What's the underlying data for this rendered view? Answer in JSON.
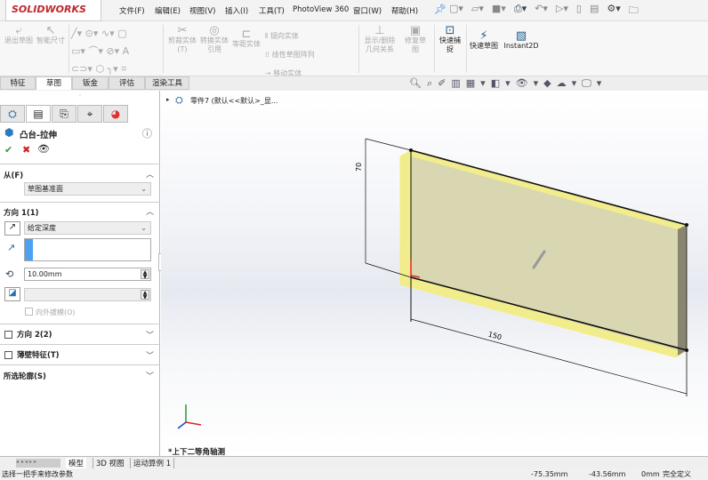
{
  "app": {
    "logo": "SOLIDWORKS"
  },
  "menu": [
    "文件(F)",
    "编辑(E)",
    "视图(V)",
    "插入(I)",
    "工具(T)",
    "PhotoView 360",
    "窗口(W)",
    "帮助(H)"
  ],
  "ribbon": {
    "exit_sketch": "退出草图",
    "smart_dim": "智能尺寸",
    "trim": "剪裁实体(T)",
    "convert": "转换实体引用",
    "offset": "等距实体",
    "mirror": "镜向实体",
    "linear_pattern": "线性草图阵列",
    "move": "移动实体",
    "relations": "显示/删除几何关系",
    "repair": "修复草图",
    "quick_snap": "快速捕捉",
    "rapid_sketch": "快速草图",
    "instant2d": "Instant2D"
  },
  "tabs": [
    "特征",
    "草图",
    "钣金",
    "评估",
    "渲染工具"
  ],
  "active_tab": 1,
  "panel": {
    "title": "凸台-拉伸",
    "from_label": "从(F)",
    "from_value": "草图基准面",
    "dir1_label": "方向 1(1)",
    "dir1_type": "给定深度",
    "depth": "10.00mm",
    "draft_label": "向外拔模(O)",
    "dir2_label": "方向 2(2)",
    "thin_label": "薄壁特征(T)",
    "contours_label": "所选轮廓(S)"
  },
  "tree": {
    "part": "零件7  (默认<<默认>_显..."
  },
  "model": {
    "dim_height": "70",
    "dim_width": "150",
    "view_name": "*上下二等角轴测",
    "face_color": "#d9d6b2",
    "edge_color": "#f5ef7a"
  },
  "bottom_tabs": [
    "模型",
    "3D 视图",
    "运动算例 1"
  ],
  "status": {
    "message": "选择一把手来修改参数",
    "x": "-75.35mm",
    "y": "-43.56mm",
    "z": "0mm",
    "state": "完全定义"
  }
}
